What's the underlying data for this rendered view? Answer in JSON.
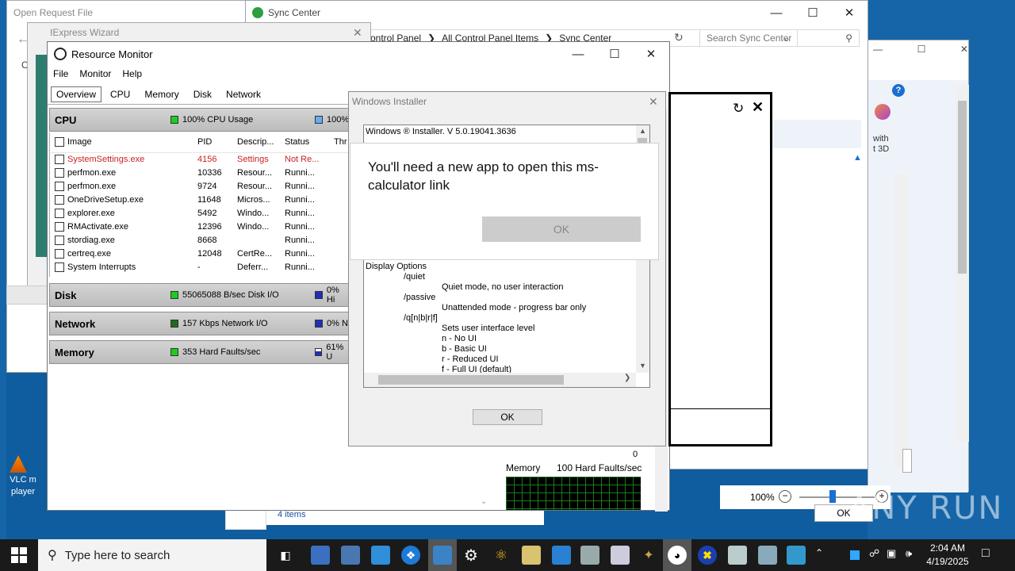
{
  "open_request": {
    "title": "Open Request File"
  },
  "sync_center": {
    "title": "Sync Center",
    "breadcrumb": [
      "ontrol Panel",
      "All Control Panel Items",
      "Sync Center"
    ],
    "search_placeholder": "Search Sync Center",
    "items_count": "4 items"
  },
  "right_window": {
    "text1": "with",
    "text2": "t 3D"
  },
  "iexpress": {
    "title": "IExpress Wizard"
  },
  "resource_monitor": {
    "title": "Resource Monitor",
    "menu": [
      "File",
      "Monitor",
      "Help"
    ],
    "tabs": [
      "Overview",
      "CPU",
      "Memory",
      "Disk",
      "Network"
    ],
    "cpu": {
      "label": "CPU",
      "usage": "100% CPU Usage",
      "freq": "100%",
      "columns": [
        "Image",
        "PID",
        "Descrip...",
        "Status",
        "Thr"
      ],
      "rows": [
        {
          "image": "SystemSettings.exe",
          "pid": "4156",
          "desc": "Settings",
          "status": "Not Re..."
        },
        {
          "image": "perfmon.exe",
          "pid": "10336",
          "desc": "Resour...",
          "status": "Runni..."
        },
        {
          "image": "perfmon.exe",
          "pid": "9724",
          "desc": "Resour...",
          "status": "Runni..."
        },
        {
          "image": "OneDriveSetup.exe",
          "pid": "11648",
          "desc": "Micros...",
          "status": "Runni..."
        },
        {
          "image": "explorer.exe",
          "pid": "5492",
          "desc": "Windo...",
          "status": "Runni..."
        },
        {
          "image": "RMActivate.exe",
          "pid": "12396",
          "desc": "Windo...",
          "status": "Runni..."
        },
        {
          "image": "stordiag.exe",
          "pid": "8668",
          "desc": "",
          "status": "Runni..."
        },
        {
          "image": "certreq.exe",
          "pid": "12048",
          "desc": "CertRe...",
          "status": "Runni..."
        },
        {
          "image": "System Interrupts",
          "pid": "-",
          "desc": "Deferr...",
          "status": "Runni..."
        }
      ]
    },
    "disk": {
      "label": "Disk",
      "metric": "55065088 B/sec Disk I/O",
      "pct": "0% Hi"
    },
    "network": {
      "label": "Network",
      "metric": "157 Kbps Network I/O",
      "pct": "0% N"
    },
    "memory": {
      "label": "Memory",
      "metric": "353 Hard Faults/sec",
      "pct": "61% U"
    },
    "graph": {
      "zero": "0",
      "mem_label": "Memory",
      "mem_faults": "100 Hard Faults/sec"
    }
  },
  "windows_installer": {
    "title": "Windows Installer",
    "version": "Windows ® Installer. V 5.0.19041.3636",
    "lines": [
      {
        "indent": 0,
        "text": "Display Options"
      },
      {
        "indent": 1,
        "text": "/quiet"
      },
      {
        "indent": 2,
        "text": "Quiet mode, no user interaction"
      },
      {
        "indent": 1,
        "text": "/passive"
      },
      {
        "indent": 2,
        "text": "Unattended mode - progress bar only"
      },
      {
        "indent": 1,
        "text": "/q[n|b|r|f]"
      },
      {
        "indent": 2,
        "text": "Sets user interface level"
      },
      {
        "indent": 2,
        "text": "n - No UI"
      },
      {
        "indent": 2,
        "text": "b - Basic UI"
      },
      {
        "indent": 2,
        "text": "r - Reduced UI"
      },
      {
        "indent": 2,
        "text": "f - Full UI (default)"
      }
    ],
    "ok": "OK"
  },
  "new_app_dialog": {
    "message": "You'll need a new app to open this ms-calculator link",
    "ok": "OK"
  },
  "zoom": {
    "level": "100%",
    "ok": "OK"
  },
  "desktop": {
    "vlc_label": "VLC m player"
  },
  "watermark": "ANY RUN",
  "taskbar": {
    "search_placeholder": "Type here to search",
    "time": "2:04 AM",
    "date": "4/19/2025"
  }
}
